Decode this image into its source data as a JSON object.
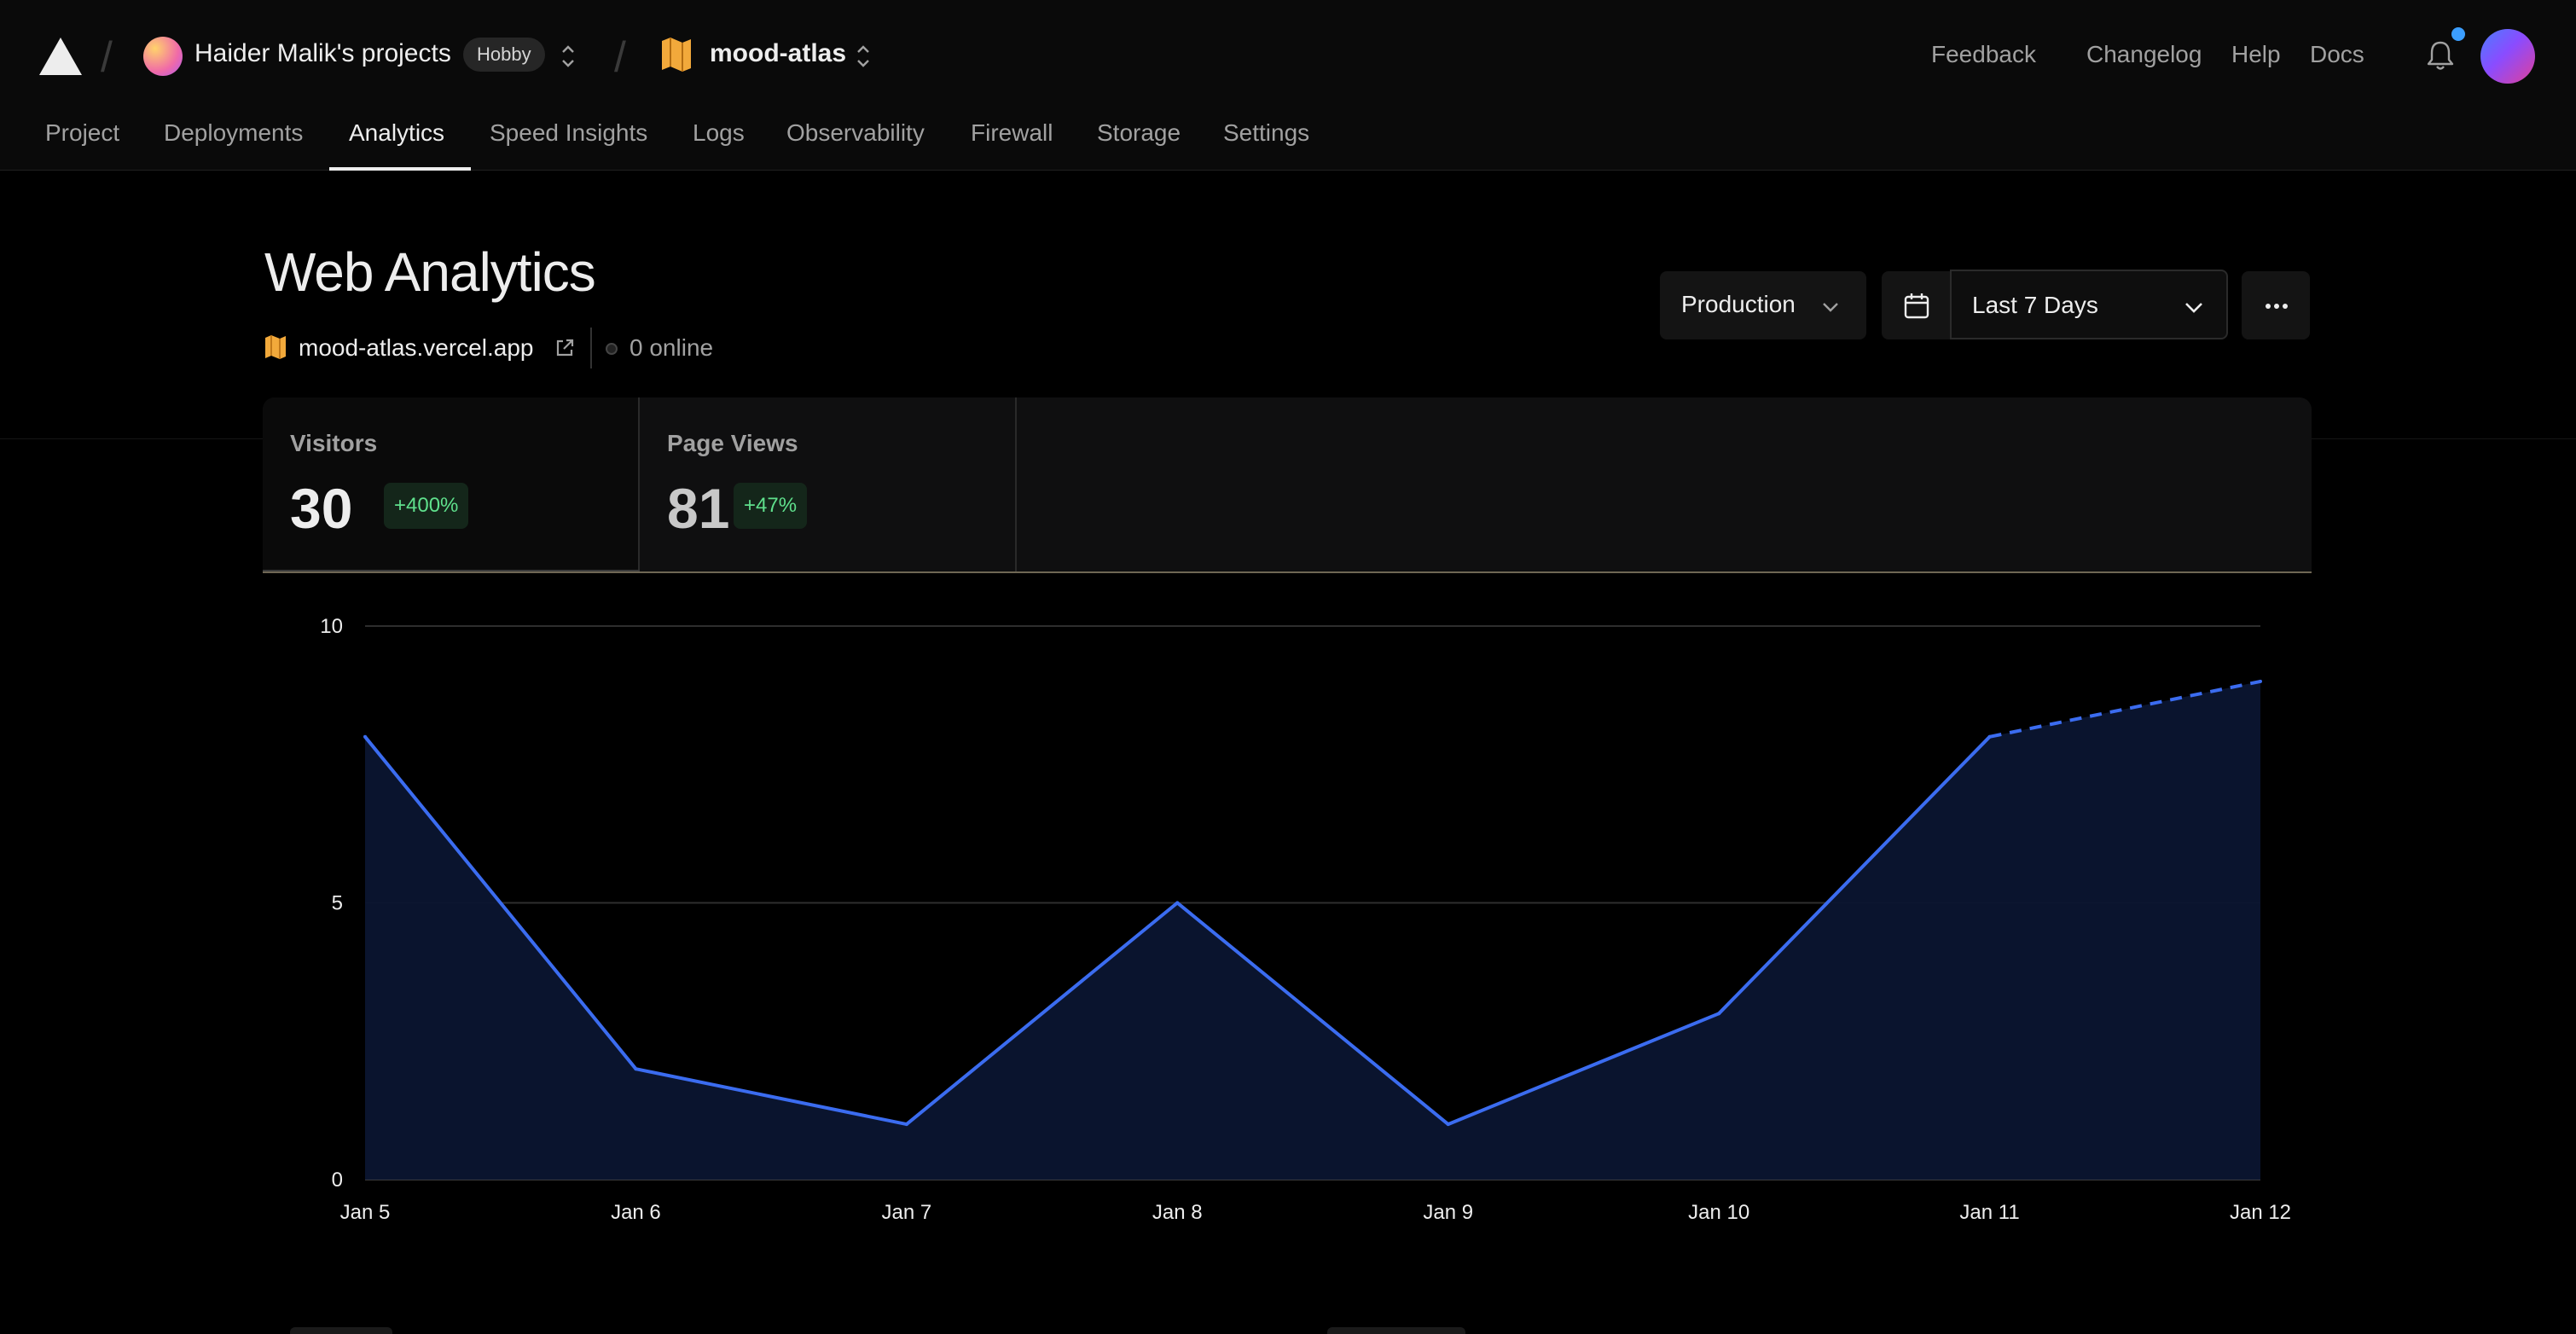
{
  "header": {
    "team_name": "Haider Malik's projects",
    "plan_badge": "Hobby",
    "project_name": "mood-atlas",
    "links": [
      "Feedback",
      "Changelog",
      "Help",
      "Docs"
    ]
  },
  "nav": {
    "tabs": [
      "Project",
      "Deployments",
      "Analytics",
      "Speed Insights",
      "Logs",
      "Observability",
      "Firewall",
      "Storage",
      "Settings"
    ],
    "active": "Analytics"
  },
  "page": {
    "title": "Web Analytics",
    "site": "mood-atlas.vercel.app",
    "online": "0 online"
  },
  "controls": {
    "environment": "Production",
    "range": "Last 7 Days"
  },
  "metrics": [
    {
      "label": "Visitors",
      "value": "30",
      "change": "+400%"
    },
    {
      "label": "Page Views",
      "value": "81",
      "change": "+47%"
    }
  ],
  "colors": {
    "accent": "#3b6cf0",
    "positive": "#5fe08c",
    "background": "#000000"
  },
  "chart_data": {
    "type": "area",
    "categories": [
      "Jan 5",
      "Jan 6",
      "Jan 7",
      "Jan 8",
      "Jan 9",
      "Jan 10",
      "Jan 11",
      "Jan 12"
    ],
    "series": [
      {
        "values": [
          8,
          2,
          1,
          5,
          1,
          3,
          8,
          9
        ]
      }
    ],
    "projected_from_index": 6,
    "yticks": [
      0,
      5,
      10
    ],
    "ylim": [
      0,
      10
    ],
    "grid": true
  }
}
